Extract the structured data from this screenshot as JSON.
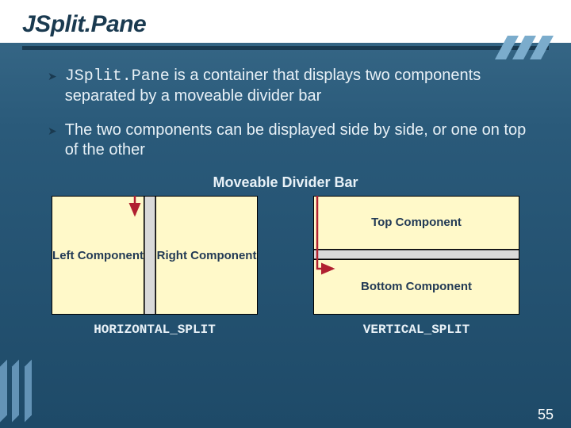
{
  "title": "JSplit.Pane",
  "bullets": [
    {
      "code": "JSplit.Pane",
      "rest": " is a container that displays two components separated by a moveable divider bar"
    },
    {
      "code": "",
      "rest": "The two components can be displayed side by side, or one on top of the other"
    }
  ],
  "dividerLabel": "Moveable Divider Bar",
  "hsplit": {
    "left": "Left Component",
    "right": "Right Component",
    "caption": "HORIZONTAL_SPLIT"
  },
  "vsplit": {
    "top": "Top Component",
    "bottom": "Bottom Component",
    "caption": "VERTICAL_SPLIT"
  },
  "pageNumber": "55"
}
